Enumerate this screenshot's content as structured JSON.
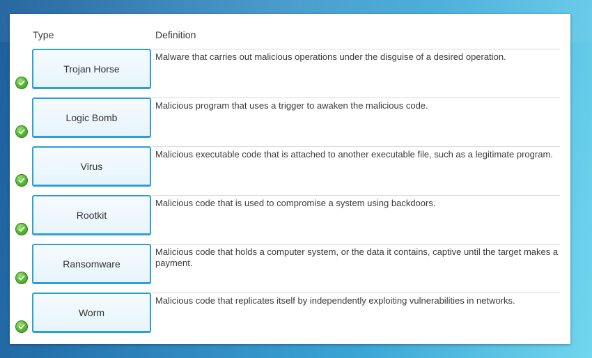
{
  "header": {
    "type_label": "Type",
    "definition_label": "Definition"
  },
  "status_icon": "check-circle-icon",
  "accent_color": "#2a9fd8",
  "check_color": "#5cbd36",
  "rows": [
    {
      "type": "Trojan Horse",
      "definition": "Malware that carries out malicious operations under the disguise of a desired operation."
    },
    {
      "type": "Logic Bomb",
      "definition": "Malicious program that uses a trigger to awaken the malicious code."
    },
    {
      "type": "Virus",
      "definition": "Malicious executable code that is attached to another executable file, such as a legitimate program."
    },
    {
      "type": "Rootkit",
      "definition": "Malicious code that is used to compromise a system using backdoors."
    },
    {
      "type": "Ransomware",
      "definition": "Malicious code that holds a computer system, or the data it contains, captive until the target makes a payment."
    },
    {
      "type": "Worm",
      "definition": "Malicious code that replicates itself by independently exploiting vulnerabilities in networks."
    }
  ]
}
